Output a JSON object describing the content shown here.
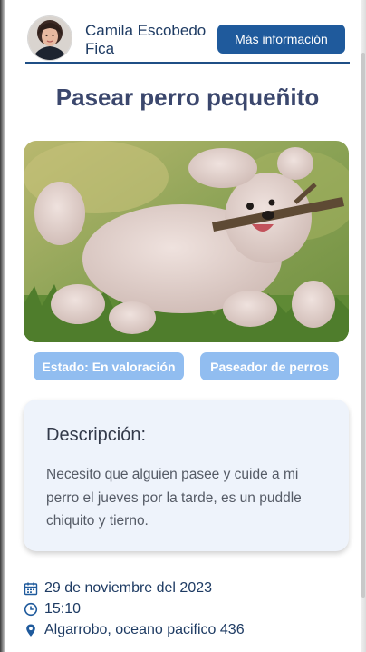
{
  "header": {
    "user_name": "Camila Escobedo Fica",
    "more_info_label": "Más información"
  },
  "task": {
    "title": "Pasear perro pequeñito",
    "status_label": "Estado: En valoración",
    "category_label": "Paseador de perros"
  },
  "description": {
    "heading": "Descripción:",
    "text": "Necesito que alguien pasee y cuide a mi perro el jueves por la tarde, es un puddle chiquito y tierno."
  },
  "details": {
    "date": "29 de noviembre del 2023",
    "time": "15:10",
    "location": "Algarrobo, oceano pacifico 436"
  },
  "icons": {
    "date": "calendar-icon",
    "time": "clock-icon",
    "location": "map-pin-icon"
  },
  "colors": {
    "primary": "#1f5a9c",
    "chip": "#91bdf0",
    "title": "#3b476d",
    "card": "#eef3fb"
  }
}
